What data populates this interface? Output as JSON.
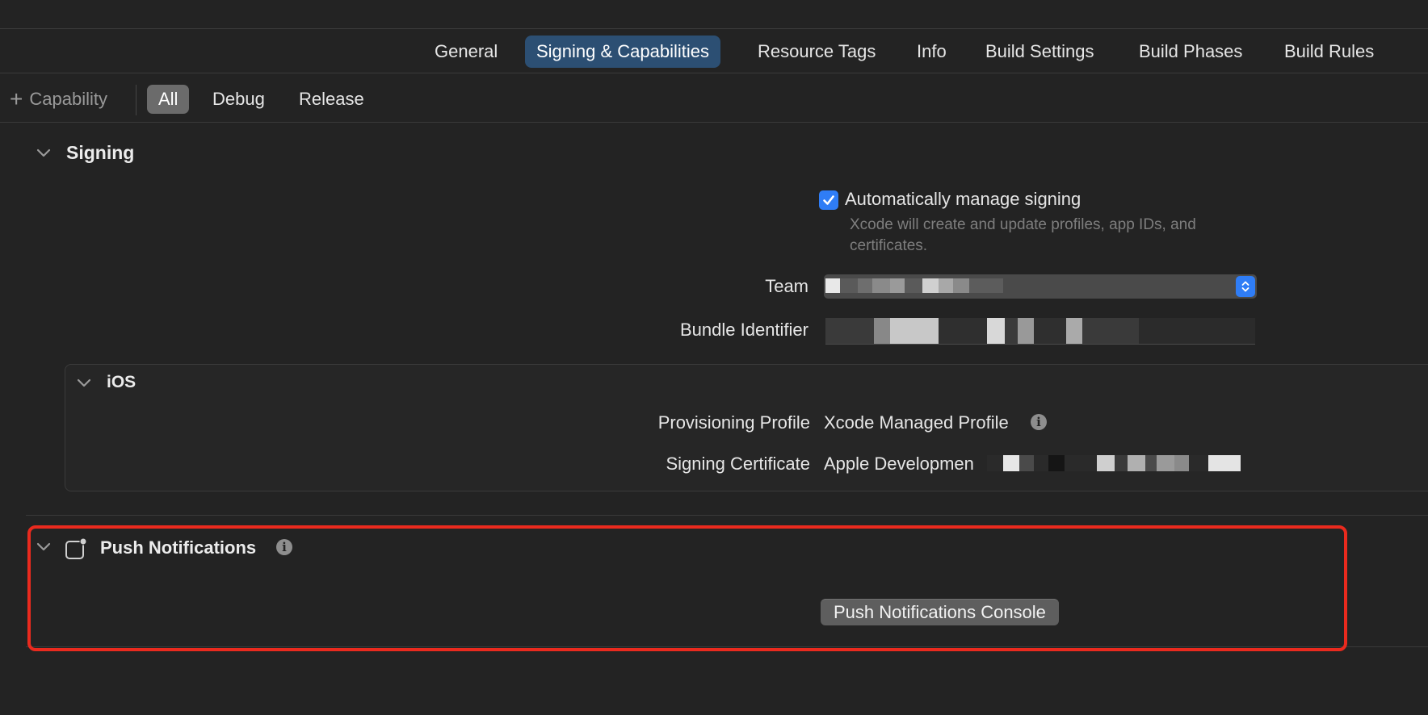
{
  "tabs": [
    {
      "label": "General",
      "active": false
    },
    {
      "label": "Signing & Capabilities",
      "active": true
    },
    {
      "label": "Resource Tags",
      "active": false
    },
    {
      "label": "Info",
      "active": false
    },
    {
      "label": "Build Settings",
      "active": false
    },
    {
      "label": "Build Phases",
      "active": false
    },
    {
      "label": "Build Rules",
      "active": false
    }
  ],
  "filterbar": {
    "add_capability": "Capability",
    "segments": [
      {
        "label": "All",
        "active": true
      },
      {
        "label": "Debug",
        "active": false
      },
      {
        "label": "Release",
        "active": false
      }
    ]
  },
  "signing": {
    "title": "Signing",
    "auto_manage": {
      "label": "Automatically manage signing",
      "checked": true,
      "help_line1": "Xcode will create and update profiles, app IDs, and",
      "help_line2": "certificates."
    },
    "team_label": "Team",
    "bundle_label": "Bundle Identifier"
  },
  "ios": {
    "title": "iOS",
    "provisioning_label": "Provisioning Profile",
    "provisioning_value": "Xcode Managed Profile",
    "certificate_label": "Signing Certificate",
    "certificate_value": "Apple Developmen"
  },
  "push": {
    "title": "Push Notifications",
    "console_button": "Push Notifications Console"
  },
  "colors": {
    "accent": "#2f7df6",
    "active_tab": "#2c4f73",
    "highlight": "#ea2a1e"
  }
}
